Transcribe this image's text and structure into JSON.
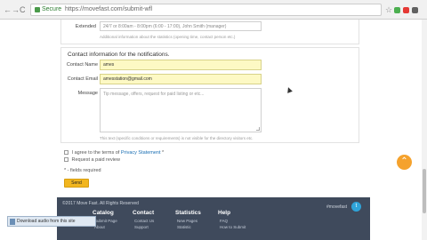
{
  "browser": {
    "back": "←",
    "forward": "→",
    "reload": "C",
    "secure_label": "Secure",
    "url": "https://movefast.com/submit-wfl",
    "star": "☆"
  },
  "form_upper": {
    "extended_label": "Extended",
    "extended_value": "24/7 or 8:00am - 8:00pm (6:00 - 17:00), John Smith (manager)",
    "extended_hint": "Additional information about the statistics (opening time, contact person etc.)"
  },
  "contact": {
    "title": "Contact information for the notifications.",
    "name_label": "Contact Name",
    "name_value": "ames",
    "email_label": "Contact Email",
    "email_value": "amesstation@gmail.com",
    "message_label": "Message",
    "message_placeholder": "Tip message, offers, request for paid listing or etc...",
    "message_hint": "This text (specific conditions or requirements) is not visible for the directory visitors etc."
  },
  "agree": {
    "prefix": "I agree to the terms of",
    "link": "Privacy Statement",
    "suffix": "*"
  },
  "paid_review": "Request a paid review",
  "required_note": "* - fields required",
  "send_label": "Send",
  "up_arrow": "⌃",
  "footer": {
    "copyright": "©2017 Move Fast. All Rights Reserved",
    "brand": "#movefast",
    "twitter": "t",
    "columns": [
      {
        "title": "Catalog",
        "items": [
          "Submit Page",
          "About"
        ]
      },
      {
        "title": "Contact",
        "items": [
          "Contact Us",
          "Support"
        ]
      },
      {
        "title": "Statistics",
        "items": [
          "New Pages",
          "Statistic"
        ]
      },
      {
        "title": "Help",
        "items": [
          "FAQ",
          "How to Submit"
        ]
      }
    ]
  },
  "download_bar": "Download audio from this site"
}
